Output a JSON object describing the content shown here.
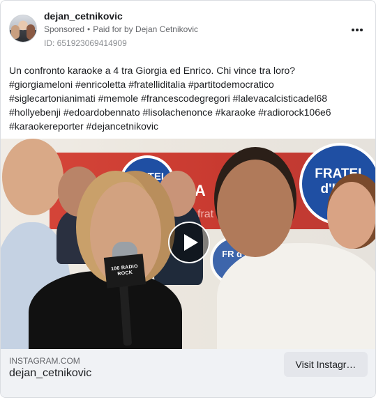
{
  "post": {
    "page_name": "dejan_cetnikovic",
    "sponsored_label": "Sponsored",
    "separator": "•",
    "paid_for": "Paid for by Dejan Cetnikovic",
    "ad_id": "ID: 651923069414909",
    "more_icon": "more-horizontal-icon",
    "text_lines": [
      "Un confronto karaoke a 4 tra Giorgia ed Enrico. Chi vince tra loro?",
      "#giorgiameloni #enricoletta #fratelliditalia #partitodemocratico",
      "#siglecartonianimati #memole #francescodegregori #lalevacalcisticadel68",
      "#hollyebenji #edoardobennato #lisolachenonce #karaoke #radiorock106e6",
      "#karaokereporter #dejancetnikovic"
    ]
  },
  "media": {
    "type": "video",
    "play_icon": "play-icon",
    "banner_text_left": "FRATEL",
    "banner_text_right": "FRATEL d'ITAL",
    "banner_text_mid": "NA",
    "banner_text_sub": "frat",
    "banner_text_fr": "FR d'I",
    "mic_label": "106 RADIO ROCK"
  },
  "footer": {
    "domain": "INSTAGRAM.COM",
    "name": "dejan_cetnikovic",
    "cta_label": "Visit Instagr…"
  },
  "colors": {
    "banner_red": "#c83a30",
    "logo_blue": "#1f4fa3",
    "footer_bg": "#f0f2f5",
    "cta_bg": "#e4e6eb"
  }
}
